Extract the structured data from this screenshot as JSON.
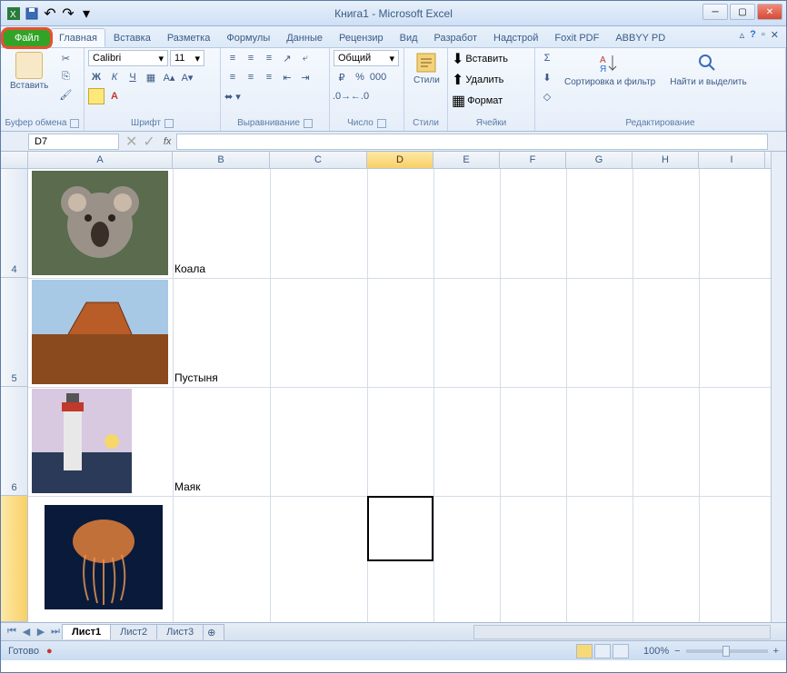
{
  "window": {
    "title": "Книга1 - Microsoft Excel"
  },
  "tabs": {
    "file": "Файл",
    "items": [
      "Главная",
      "Вставка",
      "Разметка",
      "Формулы",
      "Данные",
      "Рецензир",
      "Вид",
      "Разработ",
      "Надстрой",
      "Foxit PDF",
      "ABBYY PD"
    ],
    "active_index": 0
  },
  "ribbon": {
    "clipboard": {
      "label": "Буфер обмена",
      "paste": "Вставить"
    },
    "font": {
      "label": "Шрифт",
      "name": "Calibri",
      "size": "11"
    },
    "alignment": {
      "label": "Выравнивание"
    },
    "number": {
      "label": "Число",
      "format": "Общий"
    },
    "styles": {
      "label": "Стили",
      "button": "Стили"
    },
    "cells": {
      "label": "Ячейки",
      "insert": "Вставить",
      "delete": "Удалить",
      "format": "Формат"
    },
    "editing": {
      "label": "Редактирование",
      "sort": "Сортировка и фильтр",
      "find": "Найти и выделить"
    }
  },
  "namebox": "D7",
  "columns": [
    {
      "letter": "A",
      "width": 159
    },
    {
      "letter": "B",
      "width": 107
    },
    {
      "letter": "C",
      "width": 107
    },
    {
      "letter": "D",
      "width": 73
    },
    {
      "letter": "E",
      "width": 73
    },
    {
      "letter": "F",
      "width": 73
    },
    {
      "letter": "G",
      "width": 73
    },
    {
      "letter": "H",
      "width": 73
    },
    {
      "letter": "I",
      "width": 73
    }
  ],
  "rows": [
    {
      "num": "4",
      "height": 120
    },
    {
      "num": "5",
      "height": 120
    },
    {
      "num": "6",
      "height": 120
    },
    {
      "num": "",
      "height": 139
    }
  ],
  "cells": {
    "b4": "Коала",
    "b5": "Пустыня",
    "b6": "Маяк"
  },
  "sheets": {
    "tabs": [
      "Лист1",
      "Лист2",
      "Лист3"
    ],
    "active": 0
  },
  "status": {
    "ready": "Готово",
    "zoom": "100%"
  }
}
